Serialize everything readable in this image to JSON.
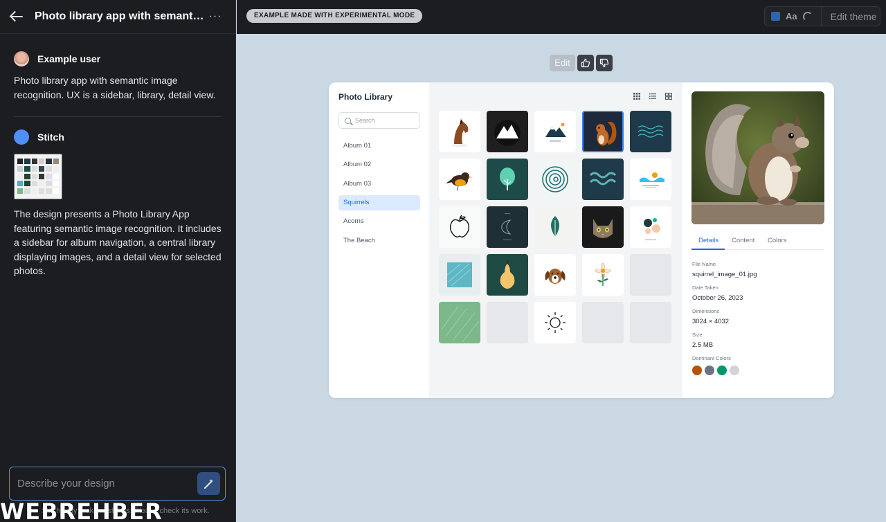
{
  "chat": {
    "title": "Photo library app with semanti...",
    "user_name": "Example user",
    "user_message": "Photo library app with semantic image recognition. UX is a sidebar, library, detail view.",
    "assistant_name": "Stitch",
    "assistant_message": "The design presents a Photo Library App featuring semantic image recognition. It includes a sidebar for album navigation, a central library displaying images, and a detail view for selected photos.",
    "input_placeholder": "Describe your design",
    "footer_note": "Stitch may make mistakes. Please check its work.",
    "watermark": "WEBREHBER"
  },
  "topbar": {
    "badge": "EXAMPLE MADE WITH EXPERIMENTAL MODE",
    "theme_aa": "Aa",
    "edit_theme": "Edit theme",
    "theme_color": "#2f63b8"
  },
  "canvas": {
    "edit_label": "Edit",
    "icons": [
      "thumbs-up-icon",
      "thumbs-down-icon"
    ]
  },
  "app": {
    "title": "Photo Library",
    "search_placeholder": "Search",
    "albums": [
      "Album 01",
      "Album 02",
      "Album 03",
      "Squirrels",
      "Acorns",
      "The Beach"
    ],
    "active_album": "Squirrels",
    "view_icons": [
      "grid-view-icon",
      "list-view-icon",
      "large-grid-view-icon"
    ],
    "tiles": [
      "horse",
      "mountain-dark",
      "mountain-light",
      "squirrel",
      "waves-dark",
      "bird",
      "tree",
      "spiral",
      "waves-teal",
      "beach",
      "apple",
      "moon",
      "leaf",
      "cat",
      "abstract-shapes",
      "water-texture",
      "pear",
      "dog",
      "flower",
      "empty",
      "grass-texture",
      "empty",
      "sun",
      "empty",
      "empty"
    ],
    "selected_tile": "squirrel",
    "detail": {
      "tabs": [
        "Details",
        "Content",
        "Colors"
      ],
      "active_tab": "Details",
      "file_name_label": "File Name",
      "file_name": "squirrel_image_01.jpg",
      "date_label": "Date Taken",
      "date": "October 26, 2023",
      "dimensions_label": "Dimensions",
      "dimensions": "3024 × 4032",
      "size_label": "Size",
      "size": "2.5 MB",
      "colors_label": "Dominant Colors",
      "colors": [
        "#b45309",
        "#6b7280",
        "#059669",
        "#d1d5db"
      ]
    }
  }
}
